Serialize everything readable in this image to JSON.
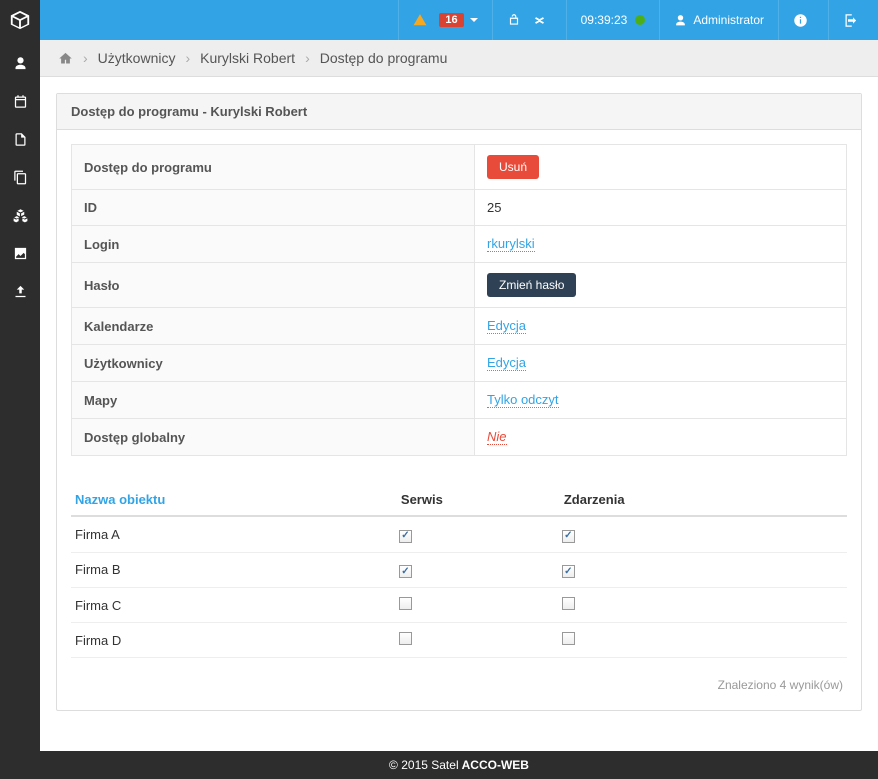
{
  "topbar": {
    "alert_count": "16",
    "time": "09:39:23",
    "user_label": "Administrator"
  },
  "breadcrumb": {
    "items": [
      "Użytkownicy",
      "Kurylski Robert",
      "Dostęp do programu"
    ]
  },
  "panel": {
    "heading": "Dostęp do programu - Kurylski Robert"
  },
  "props": {
    "rows": [
      {
        "label": "Dostęp do programu",
        "type": "btn-danger",
        "value": "Usuń"
      },
      {
        "label": "ID",
        "type": "text",
        "value": "25"
      },
      {
        "label": "Login",
        "type": "link",
        "value": "rkurylski"
      },
      {
        "label": "Hasło",
        "type": "btn-dark",
        "value": "Zmień hasło"
      },
      {
        "label": "Kalendarze",
        "type": "link",
        "value": "Edycja"
      },
      {
        "label": "Użytkownicy",
        "type": "link",
        "value": "Edycja"
      },
      {
        "label": "Mapy",
        "type": "link",
        "value": "Tylko odczyt"
      },
      {
        "label": "Dostęp globalny",
        "type": "link-red",
        "value": "Nie"
      }
    ]
  },
  "objects": {
    "headers": {
      "name": "Nazwa obiektu",
      "service": "Serwis",
      "events": "Zdarzenia"
    },
    "rows": [
      {
        "name": "Firma A",
        "service": true,
        "events": true
      },
      {
        "name": "Firma B",
        "service": true,
        "events": true
      },
      {
        "name": "Firma C",
        "service": false,
        "events": false
      },
      {
        "name": "Firma D",
        "service": false,
        "events": false
      }
    ],
    "results_text": "Znaleziono 4 wynik(ów)"
  },
  "footer": {
    "prefix": "© 2015 Satel",
    "product": "ACCO-WEB"
  }
}
